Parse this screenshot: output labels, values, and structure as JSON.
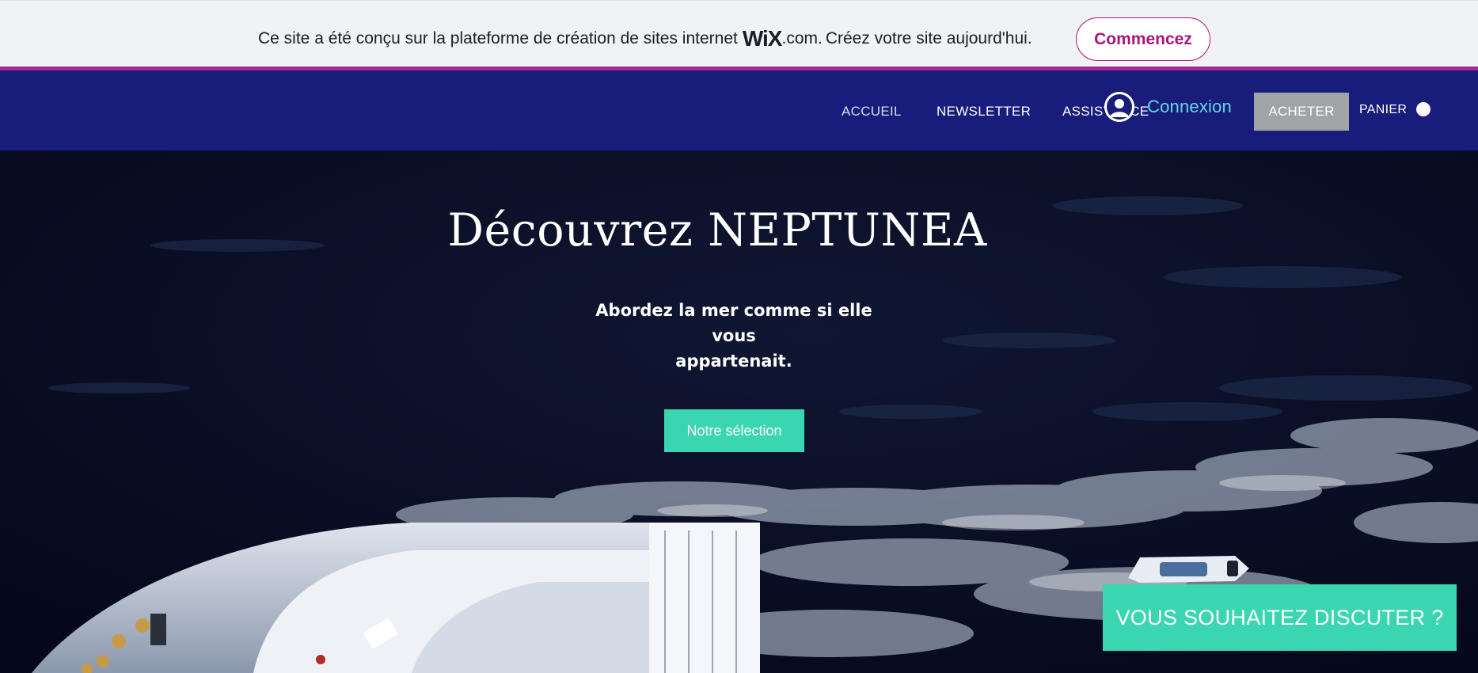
{
  "wix_banner": {
    "text_before": "Ce site a été conçu sur la plateforme de création de sites internet",
    "logo": "WiX",
    "domain": ".com.",
    "text_after": "Créez votre site aujourd'hui.",
    "start_button": "Commencez",
    "accent_color": "#a8157f"
  },
  "nav": {
    "items": [
      "ACCUEIL",
      "NEWSLETTER",
      "ASSISTANCE"
    ],
    "login_label": "Connexion",
    "login_icon": "user-avatar-icon",
    "buy_label": "ACHETER",
    "cart_label": "PANIER",
    "header_color": "#181c7b"
  },
  "hero": {
    "title": "Découvrez NEPTUNEA",
    "subtitle_line1": "Abordez la mer comme si elle vous",
    "subtitle_line2": "appartenait.",
    "button_label": "Notre sélection",
    "accent_color": "#3ad6b1"
  },
  "chat": {
    "label": "VOUS SOUHAITEZ DISCUTER ?"
  }
}
